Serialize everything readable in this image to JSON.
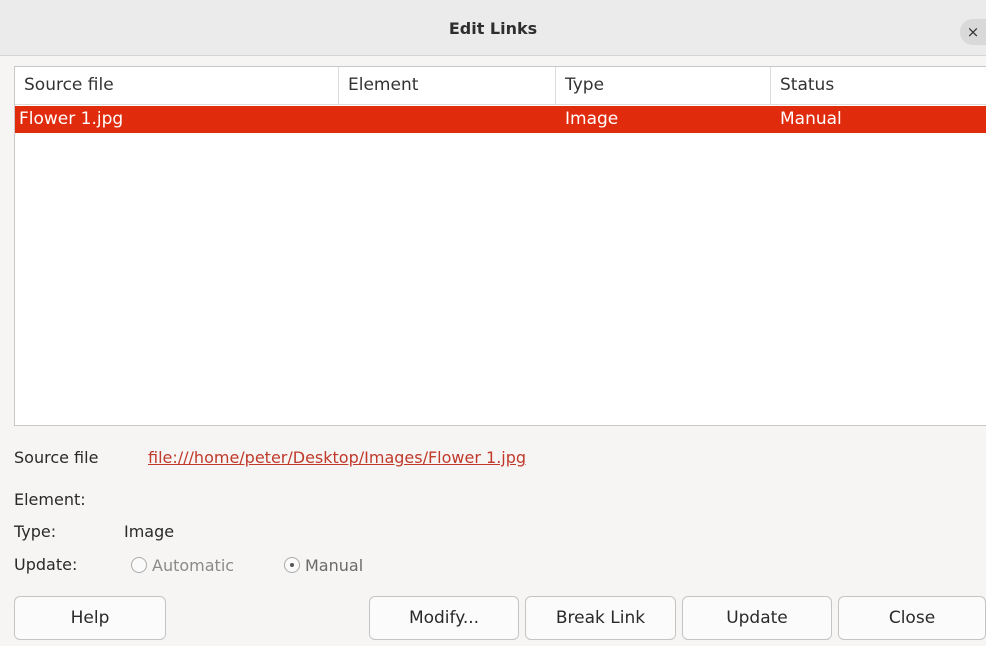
{
  "window": {
    "title": "Edit Links",
    "close_glyph": "×"
  },
  "table": {
    "columns": [
      "Source file",
      "Element",
      "Type",
      "Status"
    ],
    "rows": [
      {
        "source_file": "Flower 1.jpg",
        "element": "",
        "type": "Image",
        "status": "Manual",
        "selected": true
      }
    ]
  },
  "details": {
    "source_file_label": "Source file",
    "source_file_value": "file:///home/peter/Desktop/Images/Flower 1.jpg",
    "element_label": "Element:",
    "element_value": "",
    "type_label": "Type:",
    "type_value": "Image",
    "update_label": "Update:",
    "update_options": [
      {
        "label": "Automatic",
        "checked": false,
        "enabled": false
      },
      {
        "label": "Manual",
        "checked": true,
        "enabled": false
      }
    ]
  },
  "buttons": {
    "help": "Help",
    "modify": "Modify...",
    "break_link": "Break Link",
    "update": "Update",
    "close": "Close"
  },
  "colors": {
    "selection": "#e02b0d",
    "link": "#c0392b"
  }
}
